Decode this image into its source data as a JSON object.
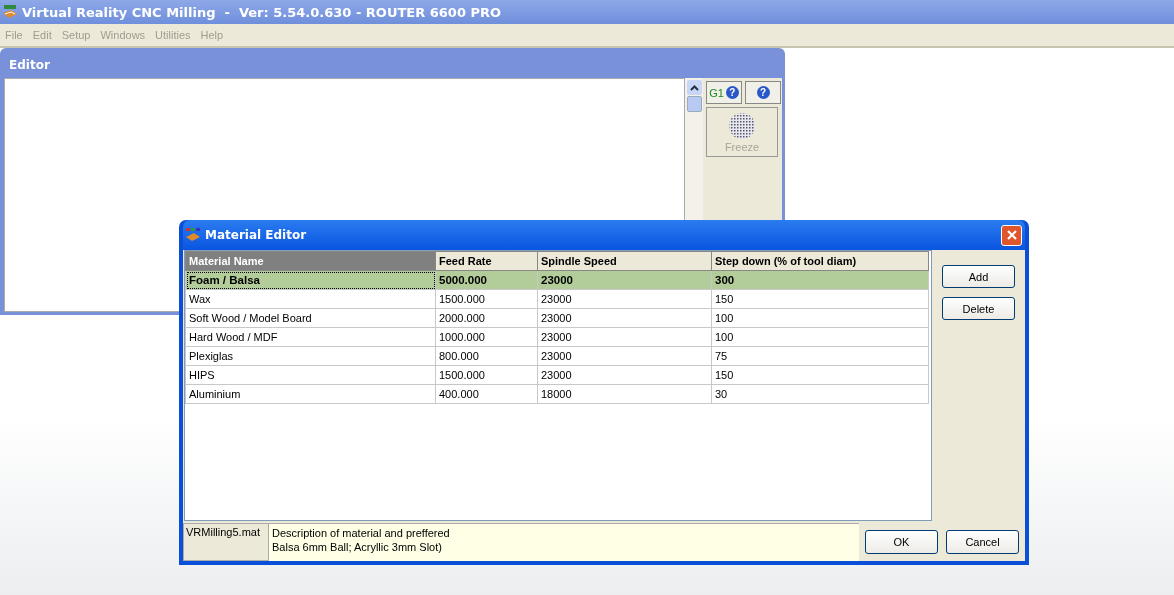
{
  "app": {
    "title": "Virtual Reality CNC Milling  -  Ver: 5.54.0.630 - ROUTER 6600 PRO"
  },
  "menu": [
    {
      "label": "File",
      "disabled": true
    },
    {
      "label": "Edit",
      "disabled": true
    },
    {
      "label": "Setup",
      "disabled": true
    },
    {
      "label": "Windows",
      "disabled": true
    },
    {
      "label": "Utilities",
      "disabled": true
    },
    {
      "label": "Help",
      "disabled": true
    }
  ],
  "editor": {
    "title": "Editor",
    "g_label": "G1",
    "help_marks": [
      "?",
      "?"
    ],
    "freeze": {
      "label": "Freeze",
      "disabled": true
    }
  },
  "dialog": {
    "title": "Material Editor",
    "columns": [
      "Material Name",
      "Feed Rate",
      "Spindle Speed",
      "Step down (% of tool diam)"
    ],
    "rows": [
      {
        "cells": [
          "Foam / Balsa",
          "5000.000",
          "23000",
          "300"
        ],
        "selected": true
      },
      {
        "cells": [
          "Wax",
          "1500.000",
          "23000",
          "150"
        ],
        "selected": false
      },
      {
        "cells": [
          "Soft Wood / Model Board",
          "2000.000",
          "23000",
          "100"
        ],
        "selected": false
      },
      {
        "cells": [
          "Hard Wood / MDF",
          "1000.000",
          "23000",
          "100"
        ],
        "selected": false
      },
      {
        "cells": [
          "Plexiglas",
          "800.000",
          "23000",
          "75"
        ],
        "selected": false
      },
      {
        "cells": [
          "HIPS",
          "1500.000",
          "23000",
          "150"
        ],
        "selected": false
      },
      {
        "cells": [
          "Aluminium",
          "400.000",
          "18000",
          "30"
        ],
        "selected": false
      }
    ],
    "side_buttons": [
      "Add",
      "Delete"
    ],
    "file": "VRMilling5.mat",
    "description": [
      "Description of material and preffered",
      "Balsa 6mm Ball; Acryllic 3mm Slot)"
    ],
    "buttons": [
      "OK",
      "Cancel"
    ]
  }
}
